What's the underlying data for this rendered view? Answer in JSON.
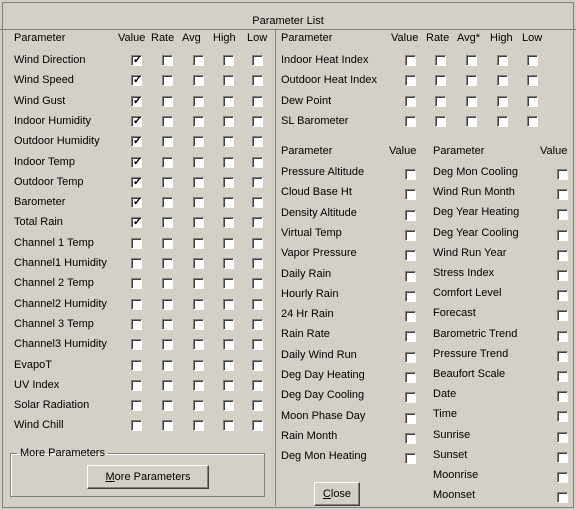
{
  "window_title": "Parameter List",
  "left_table": {
    "headers": [
      "Parameter",
      "Value",
      "Rate",
      "Avg",
      "High",
      "Low"
    ],
    "rows": [
      {
        "name": "Wind Direction",
        "checks": [
          true,
          false,
          false,
          false,
          false
        ]
      },
      {
        "name": "Wind Speed",
        "checks": [
          true,
          false,
          false,
          false,
          false
        ]
      },
      {
        "name": "Wind Gust",
        "checks": [
          true,
          false,
          false,
          false,
          false
        ]
      },
      {
        "name": "Indoor Humidity",
        "checks": [
          true,
          false,
          false,
          false,
          false
        ]
      },
      {
        "name": "Outdoor Humidity",
        "checks": [
          true,
          false,
          false,
          false,
          false
        ]
      },
      {
        "name": "Indoor Temp",
        "checks": [
          true,
          false,
          false,
          false,
          false
        ]
      },
      {
        "name": "Outdoor Temp",
        "checks": [
          true,
          false,
          false,
          false,
          false
        ]
      },
      {
        "name": "Barometer",
        "checks": [
          true,
          false,
          false,
          false,
          false
        ]
      },
      {
        "name": "Total Rain",
        "checks": [
          true,
          false,
          false,
          false,
          false
        ]
      },
      {
        "name": "Channel 1 Temp",
        "checks": [
          false,
          false,
          false,
          false,
          false
        ]
      },
      {
        "name": "Channel1 Humidity",
        "checks": [
          false,
          false,
          false,
          false,
          false
        ]
      },
      {
        "name": "Channel 2 Temp",
        "checks": [
          false,
          false,
          false,
          false,
          false
        ]
      },
      {
        "name": "Channel2 Humidity",
        "checks": [
          false,
          false,
          false,
          false,
          false
        ]
      },
      {
        "name": "Channel 3 Temp",
        "checks": [
          false,
          false,
          false,
          false,
          false
        ]
      },
      {
        "name": "Channel3 Humidity",
        "checks": [
          false,
          false,
          false,
          false,
          false
        ]
      },
      {
        "name": "EvapoT",
        "checks": [
          false,
          false,
          false,
          false,
          false
        ]
      },
      {
        "name": "UV Index",
        "checks": [
          false,
          false,
          false,
          false,
          false
        ]
      },
      {
        "name": "Solar Radiation",
        "checks": [
          false,
          false,
          false,
          false,
          false
        ]
      },
      {
        "name": "Wind Chill",
        "checks": [
          false,
          false,
          false,
          false,
          false
        ]
      }
    ]
  },
  "right_top_table": {
    "headers": [
      "Parameter",
      "Value",
      "Rate",
      "Avg*",
      "High",
      "Low"
    ],
    "rows": [
      {
        "name": "Indoor Heat Index",
        "checks": [
          false,
          false,
          false,
          false,
          false
        ]
      },
      {
        "name": "Outdoor Heat Index",
        "checks": [
          false,
          false,
          false,
          false,
          false
        ]
      },
      {
        "name": "Dew Point",
        "checks": [
          false,
          false,
          false,
          false,
          false
        ]
      },
      {
        "name": "SL Barometer",
        "checks": [
          false,
          false,
          false,
          false,
          false
        ]
      }
    ]
  },
  "mid_table": {
    "headers": [
      "Parameter",
      "Value"
    ],
    "rows": [
      {
        "name": "Pressure Altitude",
        "checked": false
      },
      {
        "name": "Cloud Base Ht",
        "checked": false
      },
      {
        "name": "Density Altitude",
        "checked": false
      },
      {
        "name": "Virtual Temp",
        "checked": false
      },
      {
        "name": "Vapor Pressure",
        "checked": false
      },
      {
        "name": "Daily Rain",
        "checked": false
      },
      {
        "name": "Hourly Rain",
        "checked": false
      },
      {
        "name": "24 Hr Rain",
        "checked": false
      },
      {
        "name": "Rain Rate",
        "checked": false
      },
      {
        "name": "Daily Wind Run",
        "checked": false
      },
      {
        "name": "Deg Day Heating",
        "checked": false
      },
      {
        "name": "Deg Day Cooling",
        "checked": false
      },
      {
        "name": "Moon Phase Day",
        "checked": false
      },
      {
        "name": "Rain Month",
        "checked": false
      },
      {
        "name": "Deg Mon Heating",
        "checked": false
      }
    ]
  },
  "far_table": {
    "headers": [
      "Parameter",
      "Value"
    ],
    "rows": [
      {
        "name": "Deg Mon Cooling",
        "checked": false
      },
      {
        "name": "Wind Run Month",
        "checked": false
      },
      {
        "name": "Deg Year Heating",
        "checked": false
      },
      {
        "name": "Deg Year Cooling",
        "checked": false
      },
      {
        "name": "Wind Run Year",
        "checked": false
      },
      {
        "name": "Stress Index",
        "checked": false
      },
      {
        "name": "Comfort Level",
        "checked": false
      },
      {
        "name": "Forecast",
        "checked": false
      },
      {
        "name": "Barometric Trend",
        "checked": false
      },
      {
        "name": "Pressure Trend",
        "checked": false
      },
      {
        "name": "Beaufort Scale",
        "checked": false
      },
      {
        "name": "Date",
        "checked": false
      },
      {
        "name": "Time",
        "checked": false
      },
      {
        "name": "Sunrise",
        "checked": false
      },
      {
        "name": "Sunset",
        "checked": false
      },
      {
        "name": "Moonrise",
        "checked": false
      },
      {
        "name": "Moonset",
        "checked": false
      }
    ]
  },
  "more_group": {
    "legend": "More Parameters",
    "button_label": "More Parameters",
    "button_mnemonic": "M",
    "button_rest": "ore Parameters"
  },
  "close_button": {
    "label": "Close",
    "mnemonic": "C",
    "rest": "lose"
  },
  "colors": {
    "face": "#d4d0c8",
    "shadow": "#808080",
    "highlight": "#ffffff",
    "check_bg": "#ffffff"
  }
}
